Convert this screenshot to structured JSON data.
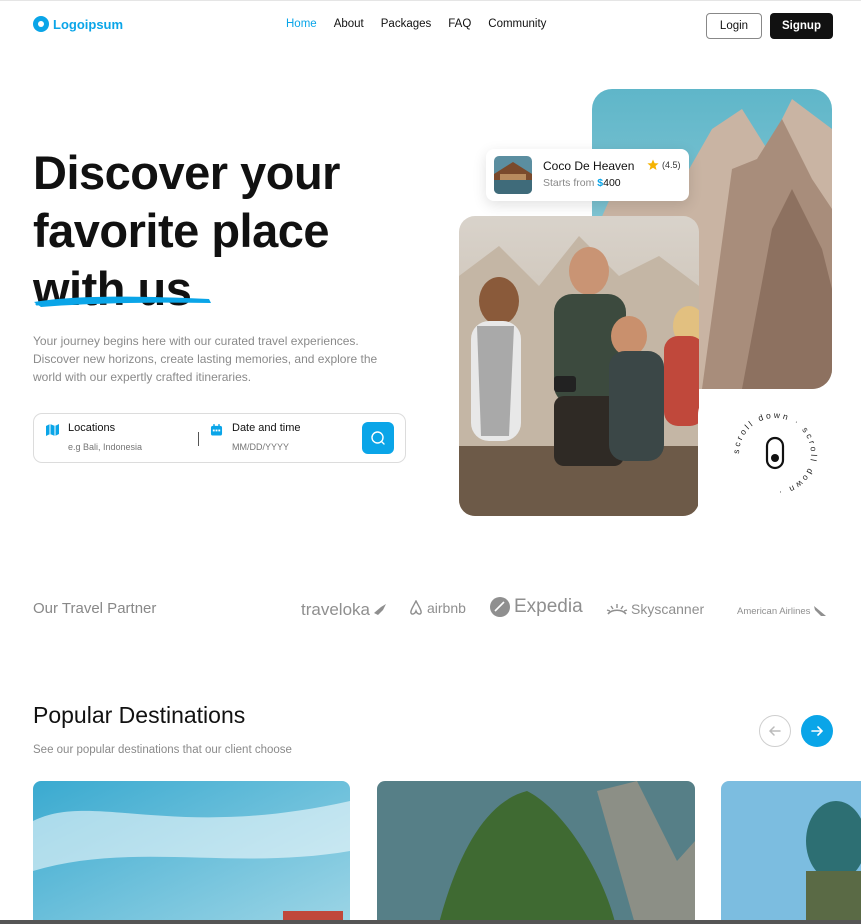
{
  "nav": {
    "logo_text": "Logoipsum",
    "menu": [
      {
        "label": "Home",
        "active": true
      },
      {
        "label": "About",
        "active": false
      },
      {
        "label": "Packages",
        "active": false
      },
      {
        "label": "FAQ",
        "active": false
      },
      {
        "label": "Community",
        "active": false
      }
    ],
    "login_label": "Login",
    "signup_label": "Signup"
  },
  "hero": {
    "title_line1": "Discover your",
    "title_line2": "favorite place",
    "title_line3": "with us",
    "description": "Your journey begins here with our curated travel experiences. Discover new horizons, create lasting memories, and explore the world with our expertly crafted itineraries.",
    "search": {
      "location_label": "Locations",
      "location_placeholder": "e.g Bali, Indonesia",
      "date_label": "Date and time",
      "date_placeholder": "MM/DD/YYYY"
    },
    "card": {
      "name": "Coco De Heaven",
      "rating": "(4.5)",
      "price_prefix": "Starts from ",
      "currency": "$",
      "price": "400"
    },
    "scroll_text": "scroll down · scroll down ·"
  },
  "partners": {
    "title": "Our Travel Partner",
    "items": [
      "traveloka",
      "airbnb",
      "Expedia",
      "Skyscanner",
      "American Airlines"
    ]
  },
  "popular": {
    "title": "Popular Destinations",
    "subtitle": "See our popular destinations that our client choose"
  },
  "colors": {
    "accent": "#0aa5e8",
    "dark": "#111111",
    "muted": "#8a8a8a"
  }
}
